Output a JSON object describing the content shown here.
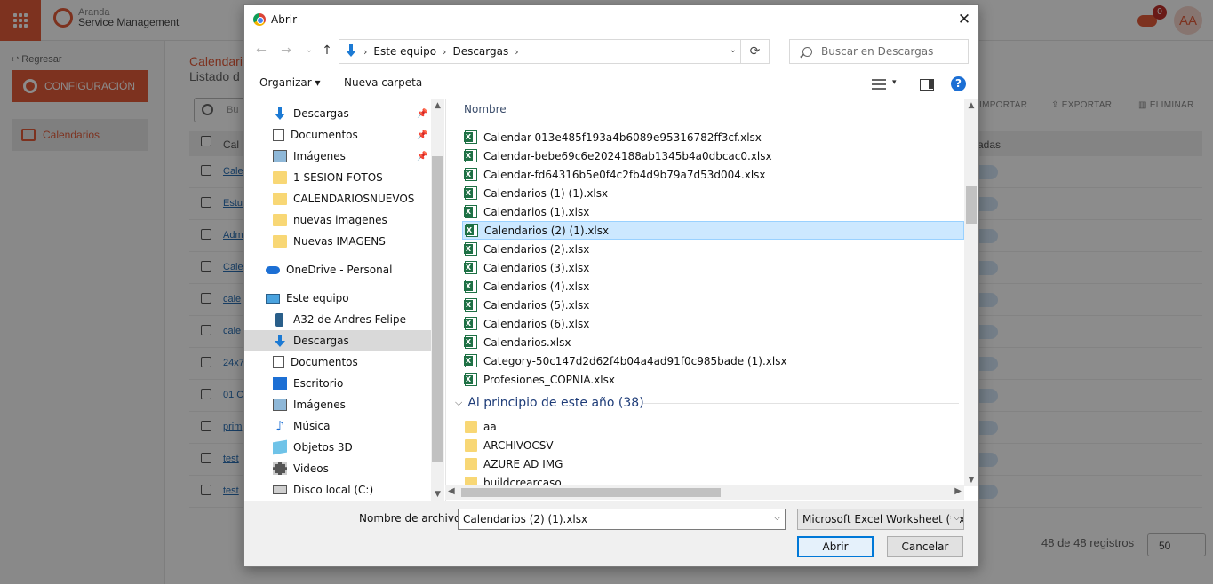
{
  "app": {
    "brand_line1": "Aranda",
    "brand_line2": "Service Management",
    "notification_count": "0",
    "avatar_initials": "AA",
    "back_label": "Regresar",
    "config_button": "CONFIGURACIÓN",
    "sidebar_item": "Calendarios",
    "page_title": "Calendario",
    "page_subtitle": "Listado d",
    "toolbar": {
      "import": "IMPORTAR",
      "export": "EXPORTAR",
      "delete": "ELIMINAR"
    },
    "search_placeholder": "Bu",
    "table_header_first": "Cal",
    "table_header_right": "adas",
    "rows": [
      "Cale",
      "Estu",
      "Adm",
      "Cale",
      "cale",
      "cale",
      "24x7",
      "01 C",
      "prim",
      "test",
      "test"
    ],
    "footer_count": "48 de 48 registros",
    "page_size": "50",
    "accent_color": "#e35b3a"
  },
  "dialog": {
    "title": "Abrir",
    "close_glyph": "✕",
    "nav": {
      "back_glyph": "←",
      "forward_glyph": "→",
      "recent_glyph": "⌄",
      "up_glyph": "↑",
      "breadcrumb": [
        "Este equipo",
        "Descargas"
      ],
      "search_placeholder": "Buscar en Descargas",
      "dropdown_glyph": "⌄",
      "refresh_glyph": "⟳"
    },
    "toolbar": {
      "organize": "Organizar ▾",
      "new_folder": "Nueva carpeta",
      "view_dropdown_glyph": "▾",
      "help_glyph": "?"
    },
    "nav_pane": [
      {
        "label": "Descargas",
        "icon": "download-icon",
        "pinned": true,
        "selected": false
      },
      {
        "label": "Documentos",
        "icon": "document-icon",
        "pinned": true,
        "selected": false
      },
      {
        "label": "Imágenes",
        "icon": "image-icon",
        "pinned": true,
        "selected": false
      },
      {
        "label": "1 SESION FOTOS",
        "icon": "folder-icon",
        "pinned": false,
        "selected": false
      },
      {
        "label": "CALENDARIOSNUEVOS",
        "icon": "folder-icon",
        "pinned": false,
        "selected": false
      },
      {
        "label": "nuevas imagenes",
        "icon": "folder-icon",
        "pinned": false,
        "selected": false
      },
      {
        "label": "Nuevas IMAGENS",
        "icon": "folder-icon",
        "pinned": false,
        "selected": false
      },
      {
        "label": "OneDrive - Personal",
        "icon": "onedrive-icon",
        "pinned": false,
        "selected": false
      },
      {
        "label": "Este equipo",
        "icon": "computer-icon",
        "pinned": false,
        "selected": false
      },
      {
        "label": "A32 de Andres Felipe",
        "icon": "phone-icon",
        "pinned": false,
        "selected": false
      },
      {
        "label": "Descargas",
        "icon": "download-icon",
        "pinned": false,
        "selected": true
      },
      {
        "label": "Documentos",
        "icon": "document-icon",
        "pinned": false,
        "selected": false
      },
      {
        "label": "Escritorio",
        "icon": "desktop-icon",
        "pinned": false,
        "selected": false
      },
      {
        "label": "Imágenes",
        "icon": "image-icon",
        "pinned": false,
        "selected": false
      },
      {
        "label": "Música",
        "icon": "music-icon",
        "pinned": false,
        "selected": false
      },
      {
        "label": "Objetos 3D",
        "icon": "3d-objects-icon",
        "pinned": false,
        "selected": false
      },
      {
        "label": "Videos",
        "icon": "video-icon",
        "pinned": false,
        "selected": false
      },
      {
        "label": "Disco local (C:)",
        "icon": "disk-icon",
        "pinned": false,
        "selected": false
      }
    ],
    "column_header": "Nombre",
    "files": [
      {
        "name": "Calendar-013e485f193a4b6089e95316782ff3cf.xlsx",
        "type": "excel",
        "selected": false
      },
      {
        "name": "Calendar-bebe69c6e2024188ab1345b4a0dbcac0.xlsx",
        "type": "excel",
        "selected": false
      },
      {
        "name": "Calendar-fd64316b5e0f4c2fb4d9b79a7d53d004.xlsx",
        "type": "excel",
        "selected": false
      },
      {
        "name": "Calendarios (1) (1).xlsx",
        "type": "excel",
        "selected": false
      },
      {
        "name": "Calendarios (1).xlsx",
        "type": "excel",
        "selected": false
      },
      {
        "name": "Calendarios (2) (1).xlsx",
        "type": "excel",
        "selected": true
      },
      {
        "name": "Calendarios (2).xlsx",
        "type": "excel",
        "selected": false
      },
      {
        "name": "Calendarios (3).xlsx",
        "type": "excel",
        "selected": false
      },
      {
        "name": "Calendarios (4).xlsx",
        "type": "excel",
        "selected": false
      },
      {
        "name": "Calendarios (5).xlsx",
        "type": "excel",
        "selected": false
      },
      {
        "name": "Calendarios (6).xlsx",
        "type": "excel",
        "selected": false
      },
      {
        "name": "Calendarios.xlsx",
        "type": "excel",
        "selected": false
      },
      {
        "name": "Category-50c147d2d62f4b04a4ad91f0c985bade (1).xlsx",
        "type": "excel",
        "selected": false
      },
      {
        "name": "Profesiones_COPNIA.xlsx",
        "type": "excel",
        "selected": false
      }
    ],
    "group_header": "Al principio de este año (38)",
    "folders": [
      "aa",
      "ARCHIVOCSV",
      "AZURE AD IMG",
      "buildcrearcaso"
    ],
    "file_name_label": "Nombre de archivo:",
    "file_name_value": "Calendarios (2) (1).xlsx",
    "file_type": "Microsoft Excel Worksheet (*.xl",
    "open_button": "Abrir",
    "cancel_button": "Cancelar"
  }
}
